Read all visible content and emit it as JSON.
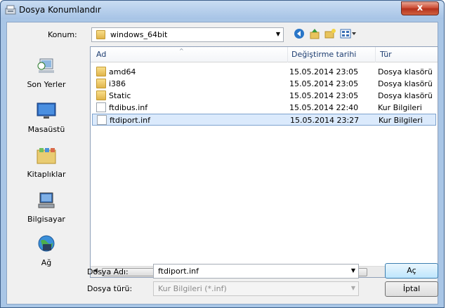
{
  "window": {
    "title": "Dosya Konumlandır",
    "close_label": "x"
  },
  "location": {
    "label": "Konum:",
    "value": "windows_64bit"
  },
  "places": [
    {
      "label": "Son Yerler",
      "icon": "recent-places-icon"
    },
    {
      "label": "Masaüstü",
      "icon": "desktop-icon"
    },
    {
      "label": "Kitaplıklar",
      "icon": "libraries-icon"
    },
    {
      "label": "Bilgisayar",
      "icon": "computer-icon"
    },
    {
      "label": "Ağ",
      "icon": "network-icon"
    }
  ],
  "columns": {
    "name": "Ad",
    "modified": "Değiştirme tarihi",
    "type": "Tür"
  },
  "files": [
    {
      "name": "amd64",
      "date": "15.05.2014 23:05",
      "type": "Dosya klasörü",
      "kind": "folder"
    },
    {
      "name": "i386",
      "date": "15.05.2014 23:05",
      "type": "Dosya klasörü",
      "kind": "folder"
    },
    {
      "name": "Static",
      "date": "15.05.2014 23:05",
      "type": "Dosya klasörü",
      "kind": "folder"
    },
    {
      "name": "ftdibus.inf",
      "date": "15.05.2014 22:40",
      "type": "Kur Bilgileri",
      "kind": "inf"
    },
    {
      "name": "ftdiport.inf",
      "date": "15.05.2014 23:27",
      "type": "Kur Bilgileri",
      "kind": "inf",
      "selected": true
    }
  ],
  "scroll_grip": "III",
  "filename": {
    "label": "Dosya Adı:",
    "value": "ftdiport.inf"
  },
  "filetype": {
    "label": "Dosya türü:",
    "value": "Kur Bilgileri (*.inf)"
  },
  "buttons": {
    "open": "Aç",
    "cancel": "İptal"
  },
  "colors": {
    "selection": "#dbeafc",
    "titlebar": "#a7c4e6",
    "close": "#c9452e"
  }
}
